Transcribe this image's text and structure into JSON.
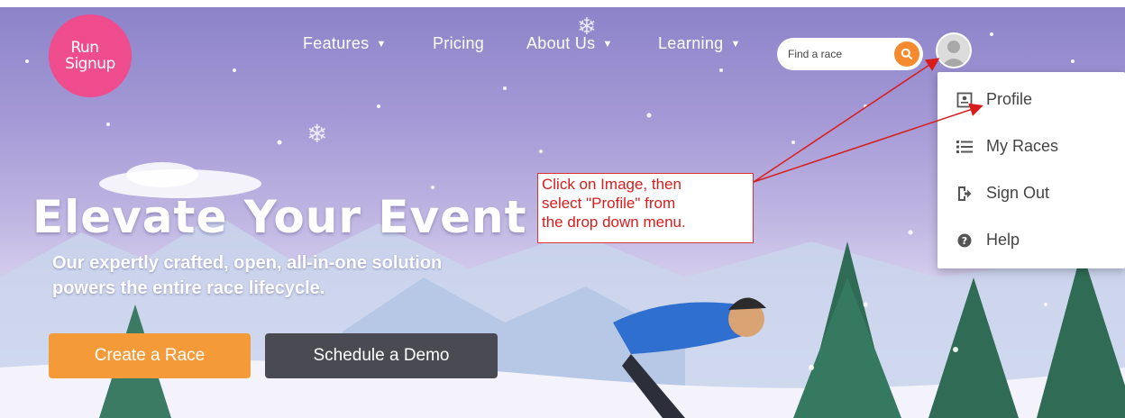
{
  "brand": {
    "logo_line1": "Run",
    "logo_line2": "Signup",
    "color": "#ee4c8c"
  },
  "nav": {
    "items": [
      {
        "label": "Features",
        "dropdown": true
      },
      {
        "label": "Pricing",
        "dropdown": false
      },
      {
        "label": "About Us",
        "dropdown": true
      },
      {
        "label": "Learning",
        "dropdown": true
      }
    ]
  },
  "search": {
    "placeholder": "Find a race",
    "icon": "search-icon",
    "accent": "#f58a2e"
  },
  "user_menu": {
    "avatar_icon": "user-avatar-icon",
    "items": [
      {
        "label": "Profile",
        "icon": "profile-card-icon"
      },
      {
        "label": "My Races",
        "icon": "list-icon"
      },
      {
        "label": "Sign Out",
        "icon": "sign-out-icon"
      },
      {
        "label": "Help",
        "icon": "help-circle-icon"
      }
    ]
  },
  "hero": {
    "headline": "Elevate Your Event",
    "subtext_line1": "Our expertly crafted, open, all-in-one solution",
    "subtext_line2": "powers the entire race lifecycle.",
    "primary_button": "Create a Race",
    "secondary_button": "Schedule a Demo",
    "primary_color": "#f49a38",
    "secondary_color": "#4a4a52"
  },
  "annotation": {
    "line1": "Click on Image, then",
    "line2": "select \"Profile\" from",
    "line3": "the drop down menu.",
    "color": "#d81c1c"
  }
}
